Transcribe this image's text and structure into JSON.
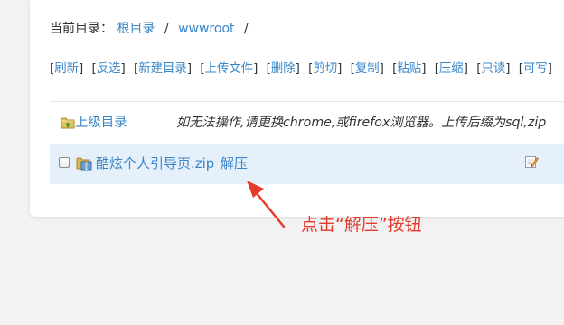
{
  "breadcrumb": {
    "prefix": "当前目录：",
    "root": "根目录",
    "sep1": "/",
    "folder": "wwwroot",
    "sep2": "/"
  },
  "toolbar": {
    "items": [
      "刷新",
      "反选",
      "新建目录",
      "上传文件",
      "删除",
      "剪切",
      "复制",
      "粘贴",
      "压缩",
      "只读",
      "可写"
    ]
  },
  "rows": {
    "parent": {
      "icon": "folder-up-icon",
      "label": "上级目录",
      "note": "如无法操作,请更换chrome,或firefox浏览器。上传后缀为sql,zip"
    },
    "file": {
      "icon": "zip-archive-icon",
      "name": "酷炫个人引导页.zip",
      "unzip_label": "解压",
      "edit_icon": "edit-pencil-icon"
    }
  },
  "annotation": {
    "text": "点击“解压”按钮",
    "color": "#e53b2c"
  },
  "colors": {
    "link": "#3a86c8",
    "selected_row": "#e6f0fb",
    "background": "#f2f2f2"
  }
}
